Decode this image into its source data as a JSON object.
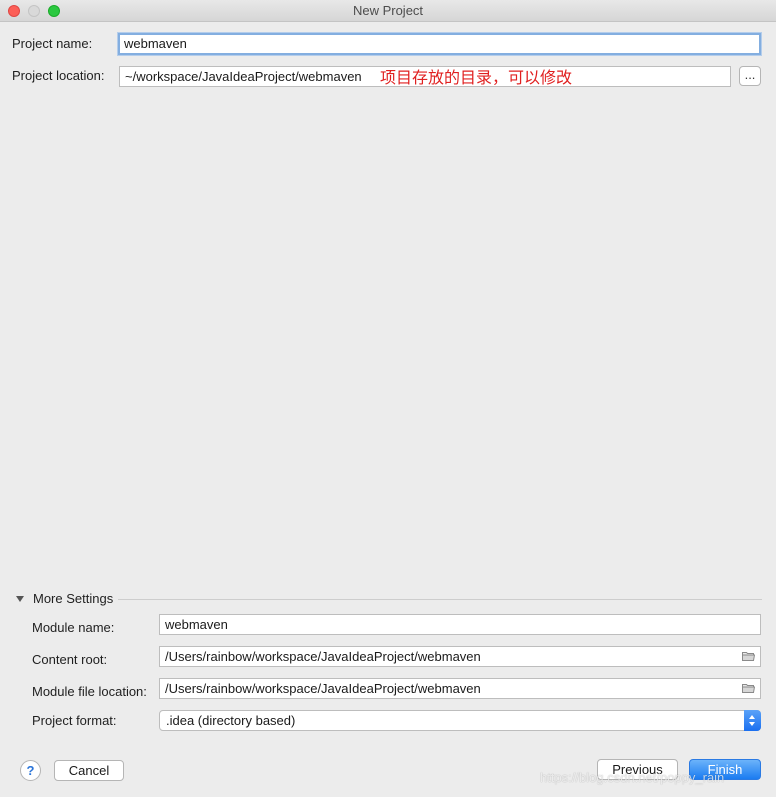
{
  "window": {
    "title": "New Project"
  },
  "form": {
    "project_name_label": "Project name:",
    "project_name_value": "webmaven",
    "project_location_label": "Project location:",
    "project_location_value": "~/workspace/JavaIdeaProject/webmaven",
    "browse_label": "...",
    "annotation": "项目存放的目录，可以修改"
  },
  "more_settings": {
    "header": "More Settings",
    "module_name_label": "Module name:",
    "module_name_value": "webmaven",
    "content_root_label": "Content root:",
    "content_root_value": "/Users/rainbow/workspace/JavaIdeaProject/webmaven",
    "module_file_location_label": "Module file location:",
    "module_file_location_value": "/Users/rainbow/workspace/JavaIdeaProject/webmaven",
    "project_format_label": "Project format:",
    "project_format_value": ".idea (directory based)"
  },
  "buttons": {
    "help": "?",
    "cancel": "Cancel",
    "previous": "Previous",
    "finish": "Finish"
  },
  "watermark": "https://blog.csdn.net/poppy_rain",
  "colors": {
    "annotation": "#e02020",
    "primary_button": "#1b7cf1",
    "focus_ring": "#83aee0"
  },
  "icons": {
    "close": "traffic-light-close",
    "minimize": "traffic-light-minimize",
    "maximize": "traffic-light-maximize",
    "folder": "folder-icon",
    "disclosure": "disclosure-triangle-icon",
    "select_arrows": "updown-arrows-icon"
  }
}
